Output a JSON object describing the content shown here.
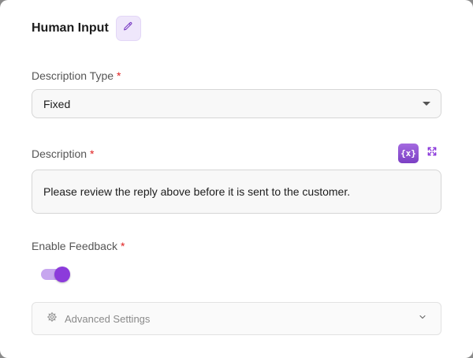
{
  "header": {
    "title": "Human Input"
  },
  "fields": {
    "description_type": {
      "label": "Description Type",
      "required_mark": "*",
      "value": "Fixed"
    },
    "description": {
      "label": "Description",
      "required_mark": "*",
      "value": "Please review the reply above before it is sent to the customer.",
      "variable_button_label": "{x}"
    },
    "enable_feedback": {
      "label": "Enable Feedback",
      "required_mark": "*",
      "enabled": true
    }
  },
  "advanced": {
    "label": "Advanced Settings"
  },
  "icons": {
    "edit": "pencil-icon",
    "variable": "variable-icon",
    "expand": "expand-icon",
    "dropdown": "caret-down-icon",
    "settings": "gear-icon",
    "accordion": "chevron-down-icon"
  },
  "colors": {
    "accent": "#8c3bdb",
    "accent_light": "#c7a6ef",
    "required": "#e02020"
  }
}
